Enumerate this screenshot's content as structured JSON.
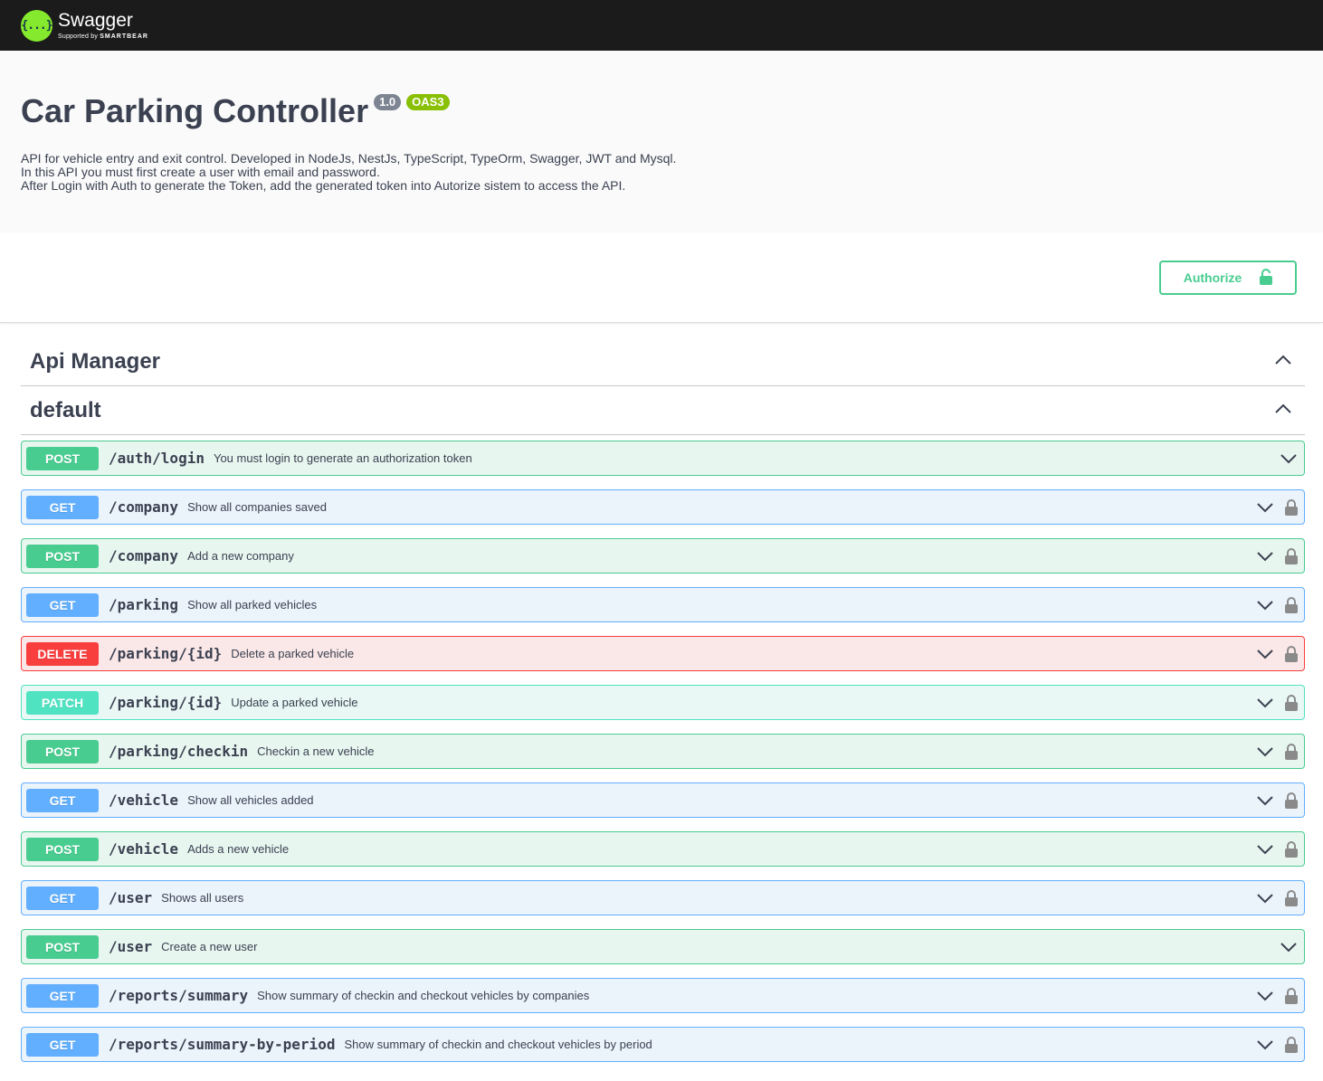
{
  "topbar": {
    "logo_glyph": "{...}",
    "brand": "Swagger",
    "supported_prefix": "Supported by",
    "supported_by": "SMARTBEAR"
  },
  "info": {
    "title": "Car Parking Controller",
    "version": "1.0",
    "oas": "OAS3",
    "description_lines": [
      "API for vehicle entry and exit control. Developed in NodeJs, NestJs, TypeScript, TypeOrm, Swagger, JWT and Mysql.",
      "In this API you must first create a user with email and password.",
      "After Login with Auth to generate the Token, add the generated token into Autorize sistem to access the API."
    ]
  },
  "authorize": {
    "label": "Authorize",
    "icon": "unlocked-icon"
  },
  "tags": [
    {
      "name": "Api Manager",
      "icon": "chevron-up-icon"
    },
    {
      "name": "default",
      "icon": "chevron-up-icon"
    }
  ],
  "operations": [
    {
      "method": "POST",
      "path": "/auth/login",
      "summary": "You must login to generate an authorization token",
      "locked": false
    },
    {
      "method": "GET",
      "path": "/company",
      "summary": "Show all companies saved",
      "locked": true
    },
    {
      "method": "POST",
      "path": "/company",
      "summary": "Add a new company",
      "locked": true
    },
    {
      "method": "GET",
      "path": "/parking",
      "summary": "Show all parked vehicles",
      "locked": true
    },
    {
      "method": "DELETE",
      "path": "/parking/{id}",
      "summary": "Delete a parked vehicle",
      "locked": true
    },
    {
      "method": "PATCH",
      "path": "/parking/{id}",
      "summary": "Update a parked vehicle",
      "locked": true
    },
    {
      "method": "POST",
      "path": "/parking/checkin",
      "summary": "Checkin a new vehicle",
      "locked": true
    },
    {
      "method": "GET",
      "path": "/vehicle",
      "summary": "Show all vehicles added",
      "locked": true
    },
    {
      "method": "POST",
      "path": "/vehicle",
      "summary": "Adds a new vehicle",
      "locked": true
    },
    {
      "method": "GET",
      "path": "/user",
      "summary": "Shows all users",
      "locked": true
    },
    {
      "method": "POST",
      "path": "/user",
      "summary": "Create a new user",
      "locked": false
    },
    {
      "method": "GET",
      "path": "/reports/summary",
      "summary": "Show summary of checkin and checkout vehicles by companies",
      "locked": true
    },
    {
      "method": "GET",
      "path": "/reports/summary-by-period",
      "summary": "Show summary of checkin and checkout vehicles by period",
      "locked": true
    }
  ],
  "colors": {
    "topbar": "#1b1b1b",
    "logo_green": "#85ea2d",
    "post": "#49cc90",
    "get": "#61affe",
    "delete": "#f93e3e",
    "patch": "#50e3c2"
  }
}
